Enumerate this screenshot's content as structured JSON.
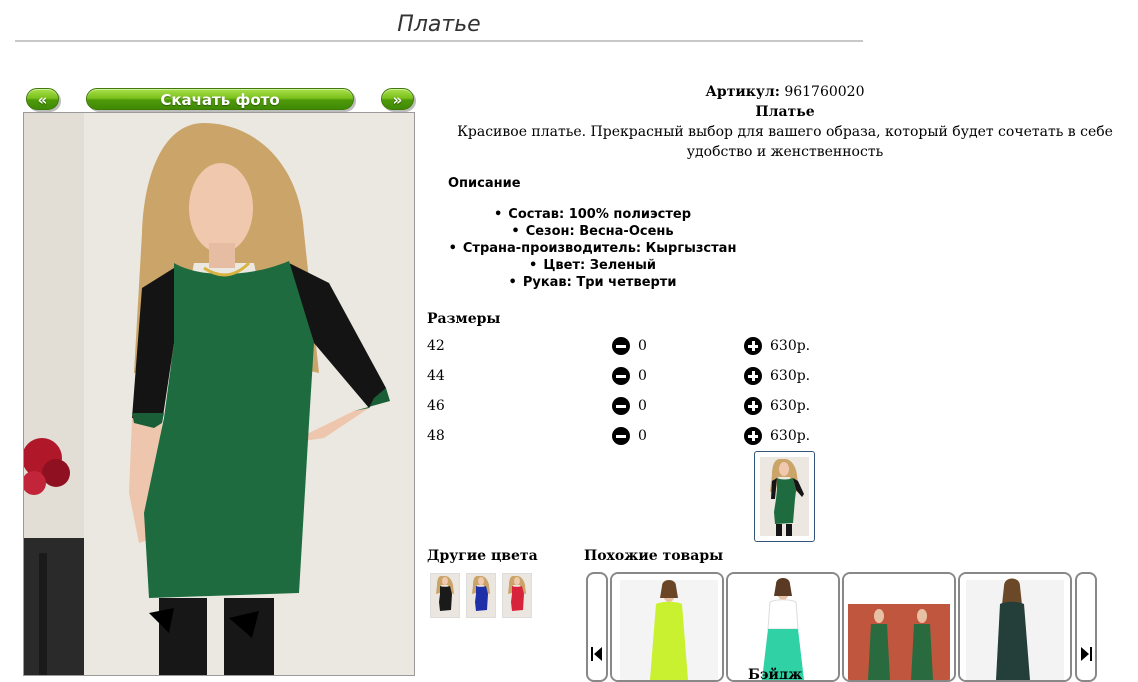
{
  "page": {
    "title": "Платье"
  },
  "nav": {
    "prev_label": "«",
    "download_label": "Скачать фото",
    "next_label": "»"
  },
  "product": {
    "sku_label": "Артикул:",
    "sku_value": "961760020",
    "name": "Платье",
    "description": "Красивое платье. Прекрасный выбор для вашего образа, который будет сочетать в себе удобство и женственность"
  },
  "details": {
    "heading": "Описание",
    "specs": [
      "Состав: 100% полиэстер",
      "Сезон: Весна-Осень",
      "Страна-производитель: Кыргызстан",
      "Цвет: Зеленый",
      "Рукав: Три четверти"
    ]
  },
  "sizes": {
    "heading": "Размеры",
    "rows": [
      {
        "size": "42",
        "qty": "0",
        "price": "630р."
      },
      {
        "size": "44",
        "qty": "0",
        "price": "630р."
      },
      {
        "size": "46",
        "qty": "0",
        "price": "630р."
      },
      {
        "size": "48",
        "qty": "0",
        "price": "630р."
      }
    ]
  },
  "other_colors": {
    "heading": "Другие цвета",
    "colors": [
      "#1a1a1a",
      "#1f2fa8",
      "#d8243a"
    ]
  },
  "similar": {
    "heading": "Похожие товары",
    "caption": "Бэйдж"
  },
  "colors": {
    "button_green": "#6bb515",
    "dress_green": "#1d6b3f",
    "border_blue": "#34557a"
  },
  "icons": {
    "prev": "chevron-left-icon",
    "next": "chevron-right-icon",
    "minus": "minus-circle-icon",
    "plus": "plus-circle-icon"
  }
}
